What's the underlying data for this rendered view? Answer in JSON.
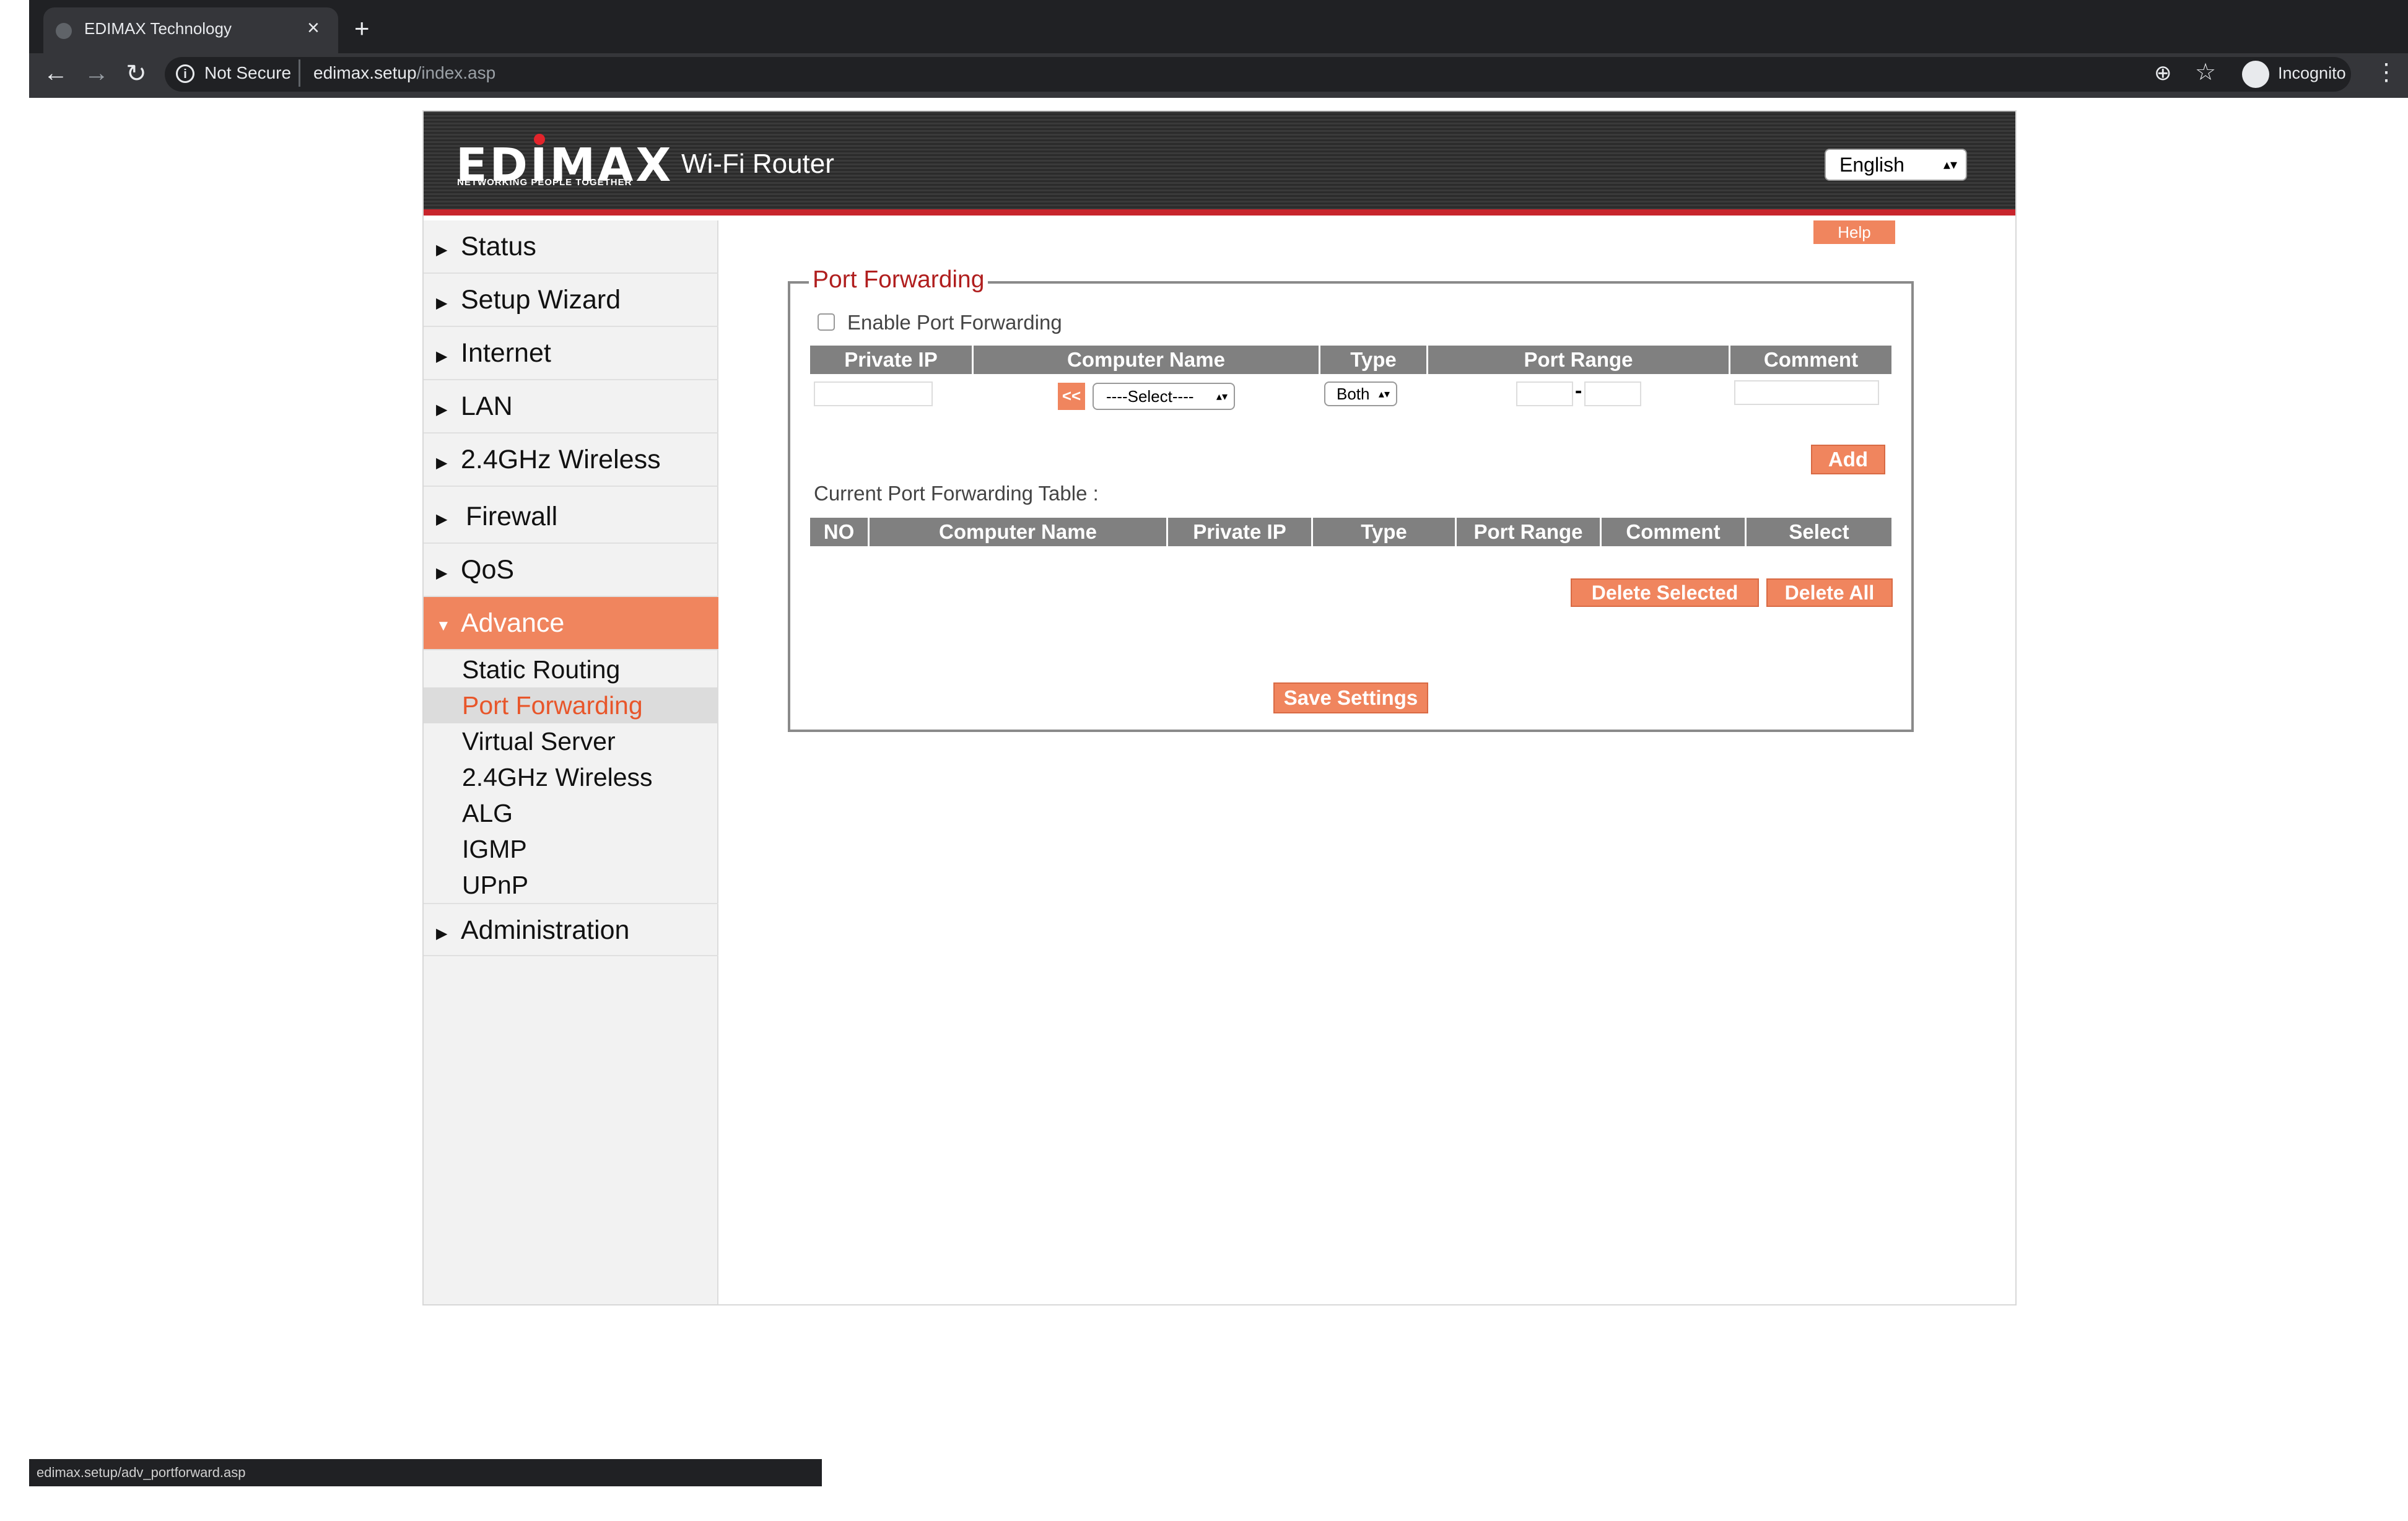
{
  "browser": {
    "tab_title": "EDIMAX Technology",
    "close_glyph": "×",
    "new_tab_glyph": "+",
    "back_glyph": "←",
    "forward_glyph": "→",
    "reload_glyph": "↻",
    "info_glyph": "i",
    "security_label": "Not Secure",
    "url_host": "edimax.setup",
    "url_path": "/index.asp",
    "zoom_glyph": "⊕",
    "star_glyph": "☆",
    "profile_label": "Incognito",
    "menu_glyph": "⋮",
    "status_url": "edimax.setup/adv_portforward.asp"
  },
  "header": {
    "logo_text": "EDIMAX",
    "logo_tagline": "NETWORKING PEOPLE TOGETHER",
    "product_name": "Wi-Fi Router",
    "language": "English",
    "select_arrow": "▴▾"
  },
  "sidebar": {
    "collapsed_glyph": "▶",
    "expanded_glyph": "▼",
    "items": [
      {
        "label": "Status"
      },
      {
        "label": "Setup Wizard"
      },
      {
        "label": "Internet"
      },
      {
        "label": "LAN"
      },
      {
        "label": "2.4GHz Wireless"
      },
      {
        "label": "Firewall"
      },
      {
        "label": "QoS"
      },
      {
        "label": "Advance"
      },
      {
        "label": "Administration"
      }
    ],
    "advance_sub": [
      {
        "label": "Static Routing"
      },
      {
        "label": "Port Forwarding"
      },
      {
        "label": "Virtual Server"
      },
      {
        "label": "2.4GHz Wireless"
      },
      {
        "label": "ALG"
      },
      {
        "label": "IGMP"
      },
      {
        "label": "UPnP"
      }
    ]
  },
  "content": {
    "help_label": "Help",
    "section_title": "Port Forwarding",
    "enable_label": "Enable  Port Forwarding",
    "enable_checked": false,
    "entry_headers": [
      "Private IP",
      "Computer Name",
      "Type",
      "Port Range",
      "Comment"
    ],
    "copy_label": "<<",
    "computer_select": "----Select----",
    "type_select": "Both",
    "port_dash": "-",
    "add_label": "Add",
    "current_table_label": "Current Port Forwarding Table :",
    "table_headers": [
      "NO",
      "Computer Name",
      "Private IP",
      "Type",
      "Port Range",
      "Comment",
      "Select"
    ],
    "delete_selected_label": "Delete Selected",
    "delete_all_label": "Delete All",
    "save_label": "Save Settings"
  },
  "colors": {
    "accent": "#f0855e",
    "title_red": "#b01e1e",
    "header_red": "#c8252c",
    "table_header": "#808080"
  }
}
